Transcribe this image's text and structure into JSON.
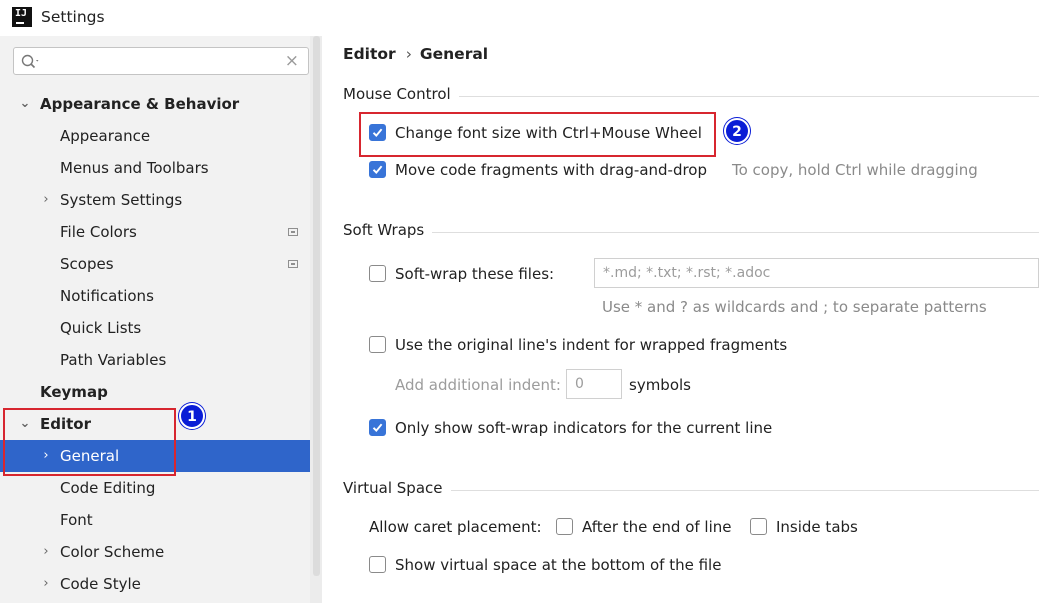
{
  "window": {
    "title": "Settings",
    "logo_text": "IJ"
  },
  "search": {
    "placeholder": "",
    "clear_glyph": "×"
  },
  "sidebar": {
    "items": [
      {
        "label": "Appearance & Behavior",
        "expanded": true
      },
      {
        "label": "Appearance"
      },
      {
        "label": "Menus and Toolbars"
      },
      {
        "label": "System Settings",
        "collapsed": true
      },
      {
        "label": "File Colors",
        "badge": true
      },
      {
        "label": "Scopes",
        "badge": true
      },
      {
        "label": "Notifications"
      },
      {
        "label": "Quick Lists"
      },
      {
        "label": "Path Variables"
      },
      {
        "label": "Keymap"
      },
      {
        "label": "Editor",
        "expanded": true
      },
      {
        "label": "General",
        "selected": true,
        "collapsed": true
      },
      {
        "label": "Code Editing"
      },
      {
        "label": "Font"
      },
      {
        "label": "Color Scheme",
        "collapsed": true
      },
      {
        "label": "Code Style",
        "collapsed": true
      }
    ]
  },
  "breadcrumb": {
    "parent": "Editor",
    "separator": "›",
    "current": "General"
  },
  "mouse_control": {
    "title": "Mouse Control",
    "change_font_size": {
      "label": "Change font size with Ctrl+Mouse Wheel",
      "checked": true
    },
    "move_code": {
      "label": "Move code fragments with drag-and-drop",
      "checked": true,
      "hint": "To copy, hold Ctrl while dragging"
    }
  },
  "soft_wraps": {
    "title": "Soft Wraps",
    "soft_wrap_files": {
      "label": "Soft-wrap these files:",
      "checked": false,
      "value": "*.md; *.txt; *.rst; *.adoc"
    },
    "pattern_hint": "Use * and ? as wildcards and ; to separate patterns",
    "original_indent": {
      "label": "Use the original line's indent for wrapped fragments",
      "checked": false
    },
    "additional_indent": {
      "label": "Add additional indent:",
      "value": "0",
      "suffix": "symbols"
    },
    "only_current_line": {
      "label": "Only show soft-wrap indicators for the current line",
      "checked": true
    }
  },
  "virtual_space": {
    "title": "Virtual Space",
    "caret_label": "Allow caret placement:",
    "after_end": {
      "label": "After the end of line",
      "checked": false
    },
    "inside_tabs": {
      "label": "Inside tabs",
      "checked": false
    },
    "show_bottom": {
      "label": "Show virtual space at the bottom of the file",
      "checked": false
    }
  },
  "annotations": {
    "one": "1",
    "two": "2"
  },
  "colors": {
    "selection": "#2f65ca",
    "checkbox": "#3874d8",
    "annotation_border": "#d7262f",
    "annotation_badge": "#0a1dd6"
  }
}
